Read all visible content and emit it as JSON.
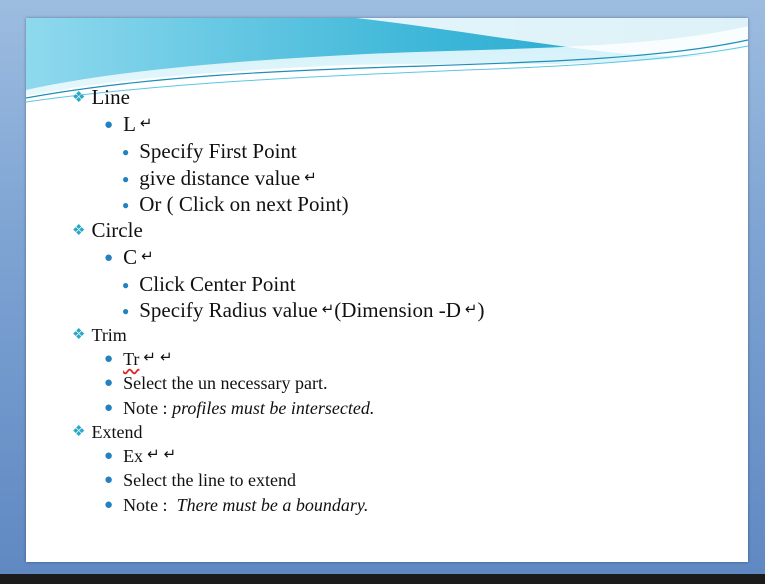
{
  "slide": {
    "sections": [
      {
        "heading": "Line",
        "command": "L",
        "steps": [
          "Specify First Point",
          "give distance value",
          "Or ( Click on  next Point)"
        ]
      },
      {
        "heading": "Circle",
        "command": "C",
        "steps": [
          "Click Center Point",
          "Specify Radius value",
          "(Dimension -D",
          ")"
        ]
      },
      {
        "heading": "Trim",
        "command": "Tr",
        "items": [
          "Select the un necessary part.",
          "Note : ",
          "profiles must be intersected."
        ]
      },
      {
        "heading": "Extend",
        "command": "Ex",
        "items": [
          "Select the line to extend",
          "Note :  ",
          "There must be a boundary."
        ]
      }
    ],
    "icons": {
      "heading_bullet": "diamond-bullet-icon",
      "list_bullet": "round-bullet-icon",
      "enter_key": "return-arrow-icon"
    },
    "colors": {
      "heading_bullet": "#2aa8c8",
      "list_bullet": "#2580c0",
      "wave_light": "#a9e3f2",
      "wave_dark": "#2fb0d2"
    }
  }
}
